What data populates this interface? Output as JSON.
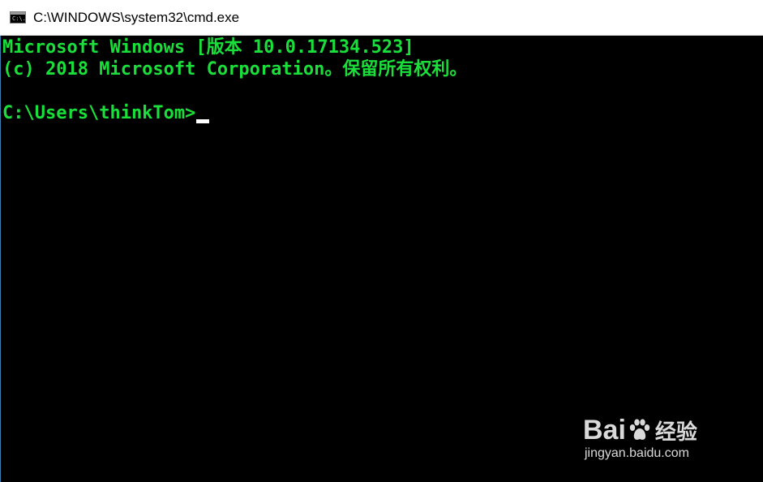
{
  "window": {
    "title": "C:\\WINDOWS\\system32\\cmd.exe",
    "icon": "cmd-icon",
    "icon_glyph": "C:\\."
  },
  "console": {
    "text_color": "#1adf3a",
    "background": "#000000",
    "lines": [
      "Microsoft Windows [版本 10.0.17134.523]",
      "(c) 2018 Microsoft Corporation。保留所有权利。"
    ],
    "prompt": "C:\\Users\\thinkTom>"
  },
  "watermark": {
    "brand_left": "Bai",
    "brand_right": "经验",
    "logo_icon": "baidu-paw-icon",
    "url": "jingyan.baidu.com"
  }
}
